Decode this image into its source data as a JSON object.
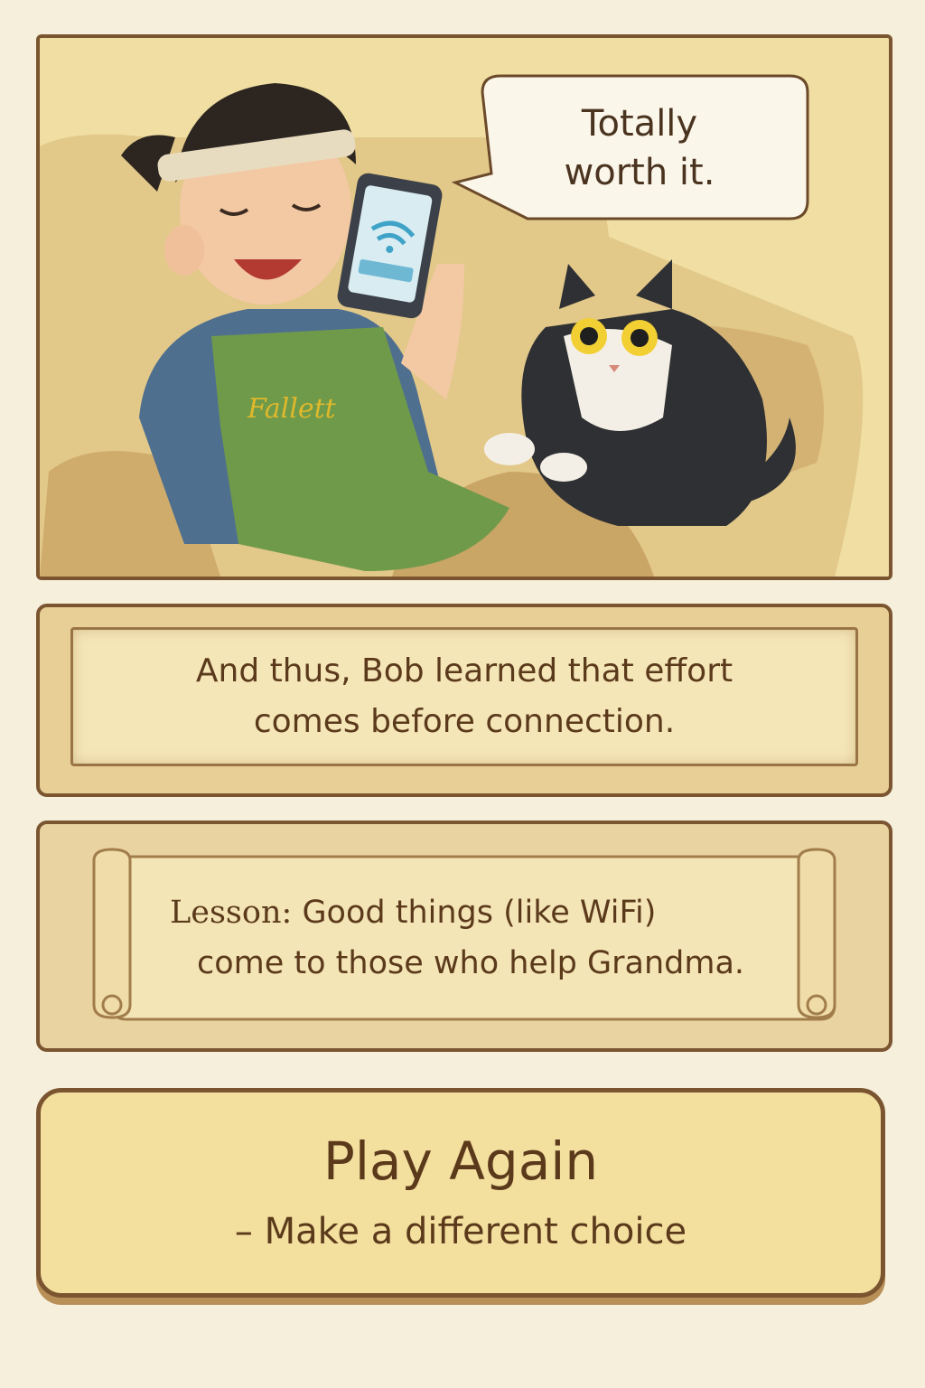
{
  "scene": {
    "speech_bubble": {
      "line1": "Totally",
      "line2": "worth it."
    },
    "apron_text": "Fallett",
    "icons": [
      "phone-icon",
      "wifi-icon"
    ]
  },
  "narration": {
    "line1": "And thus, Bob learned that effort",
    "line2": "comes before connection."
  },
  "lesson": {
    "label": "Lesson:",
    "line1": "Good things (like WiFi)",
    "line2": "come to those who help Grandma."
  },
  "play_again": {
    "title": "Play Again",
    "subtitle": "– Make a different choice"
  },
  "colors": {
    "frame": "#7a5530",
    "paper": "#f6efdc",
    "button": "#f3df9e",
    "text": "#5b3a1c"
  }
}
